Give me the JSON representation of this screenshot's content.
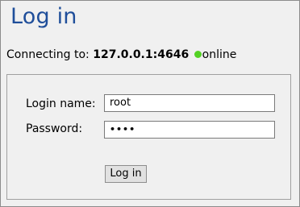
{
  "header": {
    "title": "Log in"
  },
  "connection": {
    "label": "Connecting to:",
    "host": "127.0.0.1:4646",
    "status": "online",
    "status_color": "#53d123"
  },
  "form": {
    "login_label": "Login name:",
    "login_value": "root",
    "password_label": "Password:",
    "password_value": "••••",
    "submit_label": "Log in"
  }
}
